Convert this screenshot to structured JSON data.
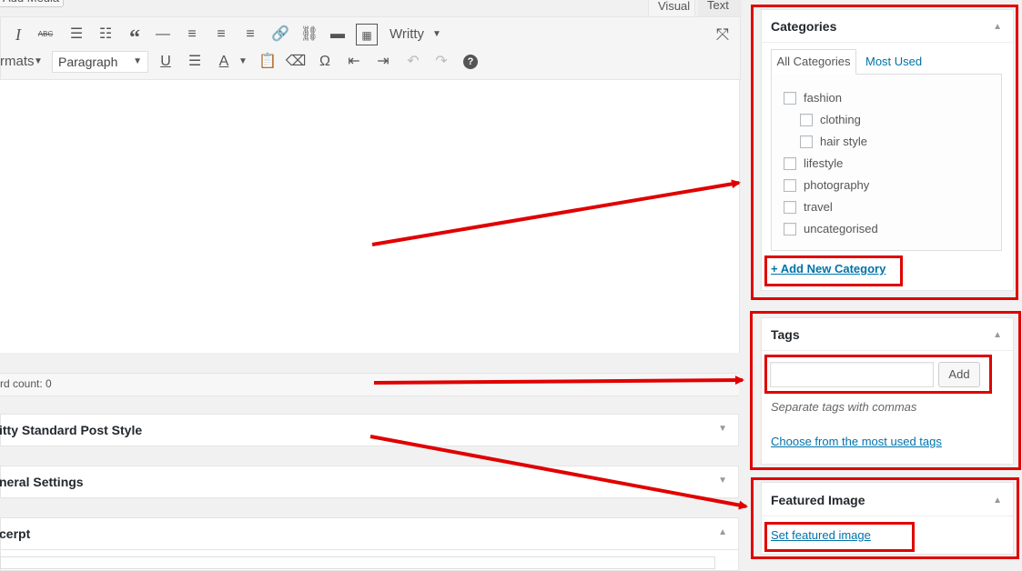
{
  "editor": {
    "add_media_label": "Add Media",
    "tab_visual": "Visual",
    "tab_text": "Text",
    "toolbar_row1": {
      "italic": "I",
      "strike": "ABC",
      "blockquote": "“",
      "hr": "—",
      "plugin_label": "Writty"
    },
    "toolbar_row2": {
      "formats_label": "rmats",
      "paragraph_select": "Paragraph",
      "underline": "U",
      "text_color": "A",
      "special_char": "Ω",
      "help": "?"
    },
    "word_count": "rd count: 0"
  },
  "metaboxes": {
    "writty_style": "itty Standard Post Style",
    "general_settings": "neral Settings",
    "excerpt": "cerpt"
  },
  "categories": {
    "title": "Categories",
    "tab_all": "All Categories",
    "tab_most_used": "Most Used",
    "items": [
      "fashion",
      "clothing",
      "hair style",
      "lifestyle",
      "photography",
      "travel",
      "uncategorised"
    ],
    "add_new_link": "+ Add New Category"
  },
  "tags": {
    "title": "Tags",
    "input_value": "",
    "add_button": "Add",
    "hint": "Separate tags with commas",
    "choose_link": "Choose from the most used tags"
  },
  "featured_image": {
    "title": "Featured Image",
    "set_link": "Set featured image"
  },
  "colors": {
    "annotation_red": "#e00000",
    "link_blue": "#0073aa"
  }
}
